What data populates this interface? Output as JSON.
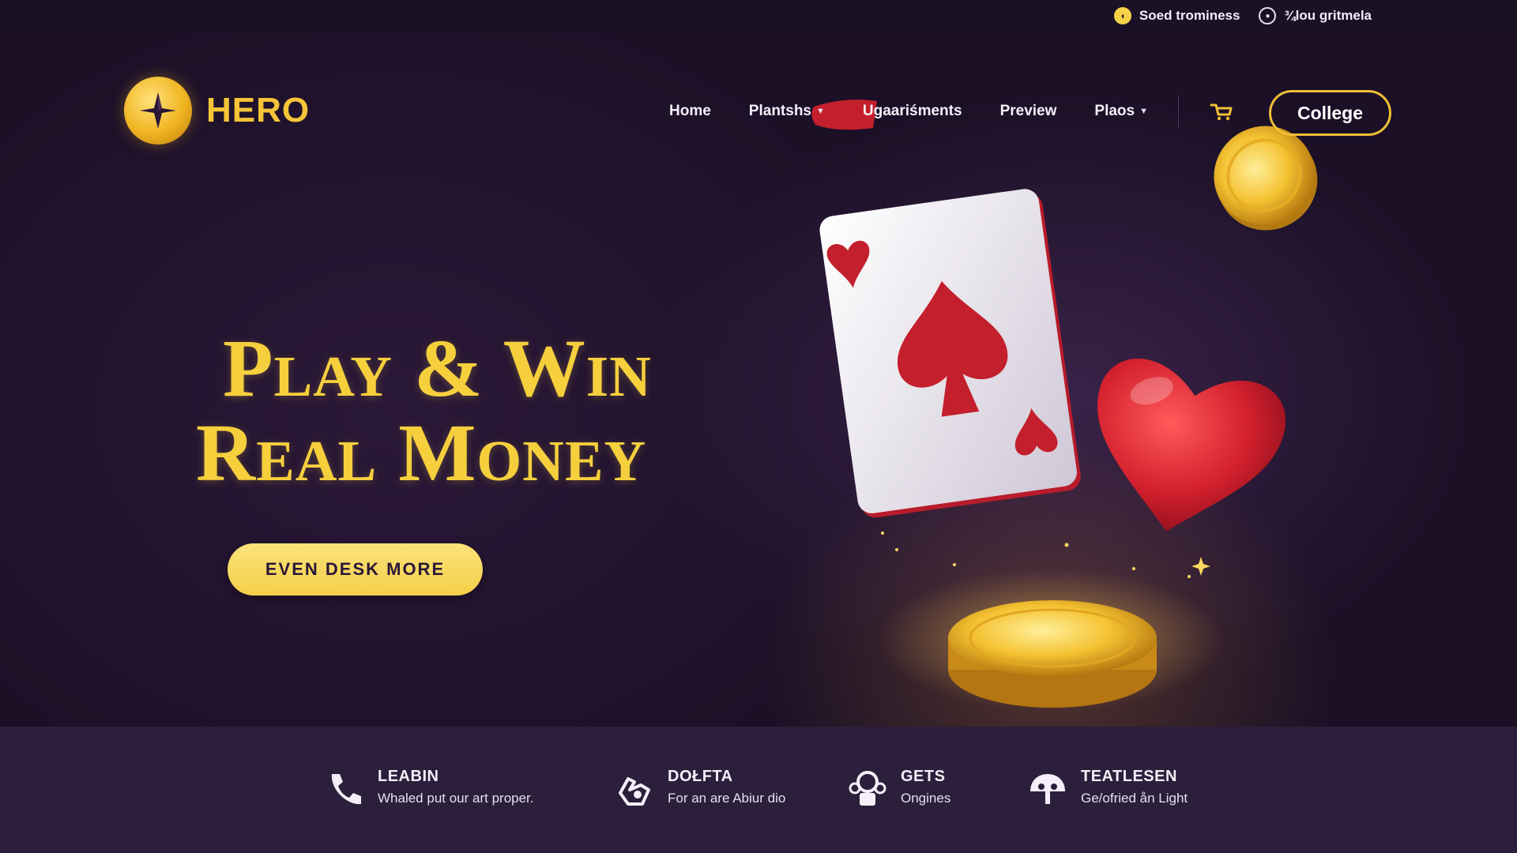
{
  "topbar": {
    "items": [
      {
        "label": "Soed trominess",
        "icon": "clock-icon"
      },
      {
        "label": "¾lou gritmela",
        "icon": "eye-icon"
      }
    ]
  },
  "brand": {
    "name": "HERO",
    "logo_icon": "star-compass-icon",
    "accent": "#f6c437"
  },
  "nav": {
    "items": [
      {
        "label": "Home",
        "dropdown": false
      },
      {
        "label": "Plantshs",
        "dropdown": true
      },
      {
        "label": "Ugaariśments",
        "dropdown": false
      },
      {
        "label": "Preview",
        "dropdown": false
      },
      {
        "label": "Plaos",
        "dropdown": true
      }
    ],
    "cart_icon": "cart-icon",
    "cta_label": "College"
  },
  "hero": {
    "headline_line1": "Play & Win",
    "headline_line2": "Real Money",
    "cta_label": "EVEN DESK MORE",
    "illustration": [
      "playing-card-icon",
      "heart-icon",
      "gold-coin-icon",
      "coin-platform-icon"
    ]
  },
  "features": [
    {
      "icon": "phone-icon",
      "title": "LEABIN",
      "subtitle": "Whaled put our art proper."
    },
    {
      "icon": "gamepad-hand-icon",
      "title": "DOŁFTA",
      "subtitle": "For an are Abiur dio"
    },
    {
      "icon": "trophy-icon",
      "title": "GETS",
      "subtitle": "Ongines"
    },
    {
      "icon": "cloud-umbrella-icon",
      "title": "TEATLESEN",
      "subtitle": "Ge/ofried ån Light"
    }
  ],
  "colors": {
    "background": "#1e1228",
    "strip": "#2c1f3b",
    "gold": "#f6cf3d",
    "heart": "#d3202e"
  }
}
